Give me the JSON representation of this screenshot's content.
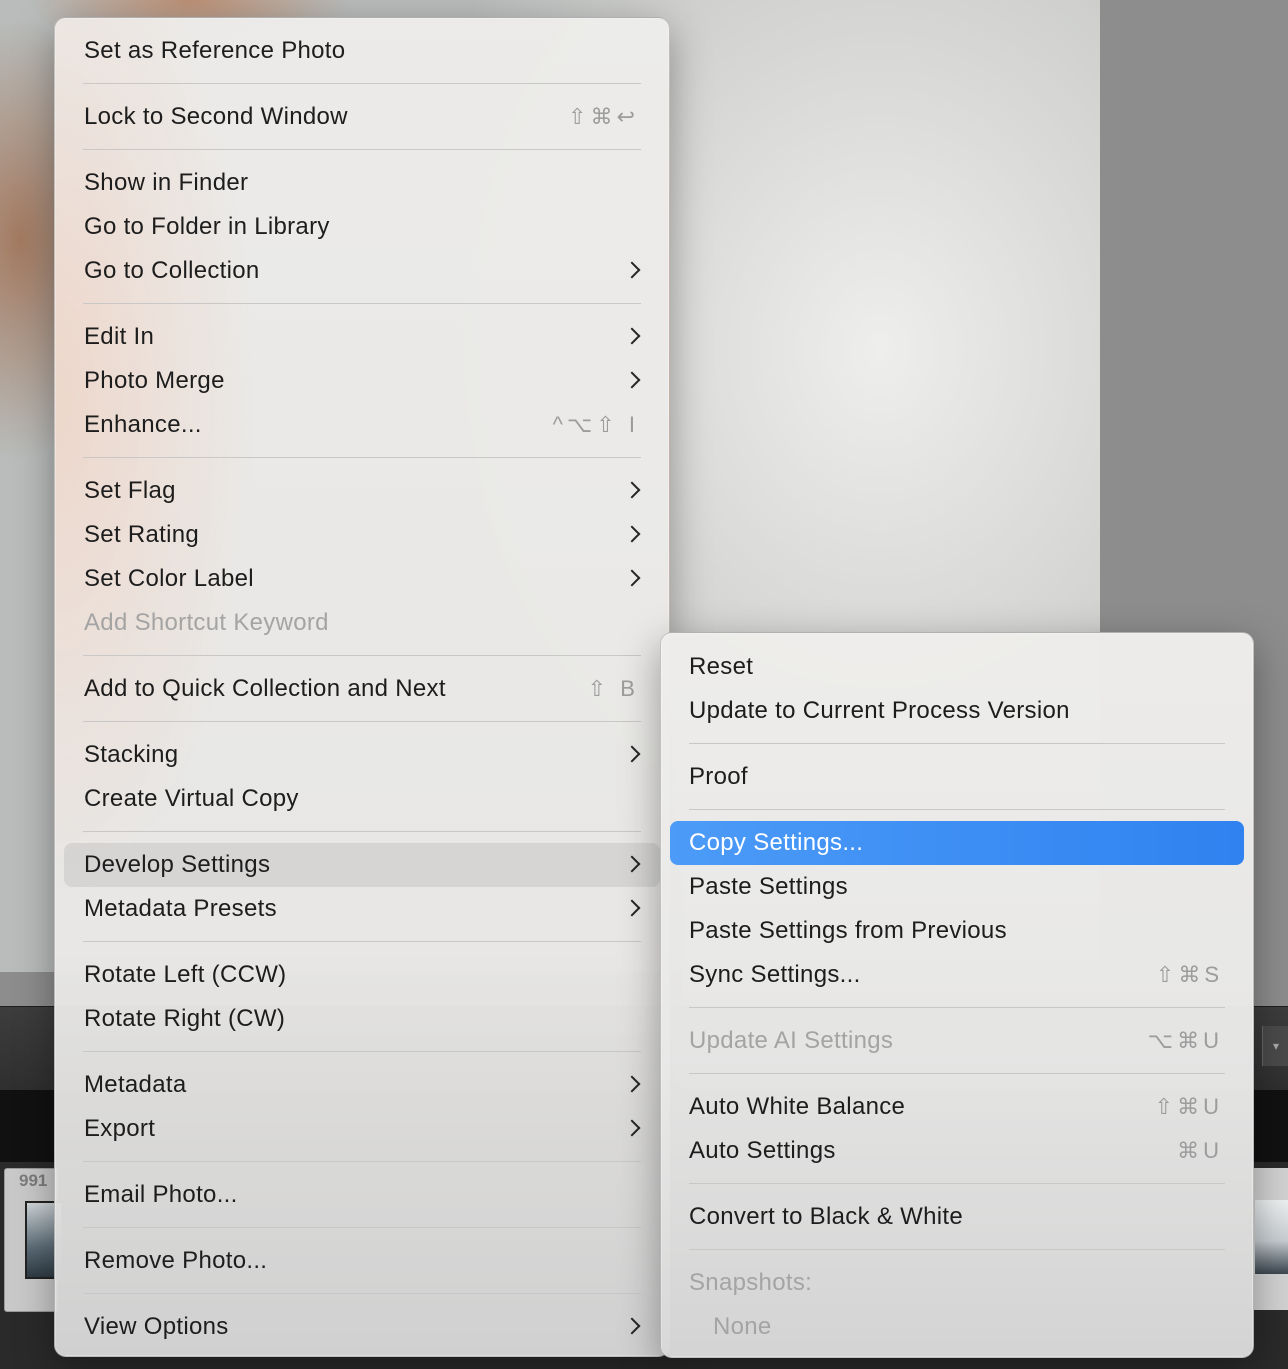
{
  "background": {
    "filmstrip_thumb_number": "991"
  },
  "context_menu": {
    "groups": [
      [
        {
          "label": "Set as Reference Photo"
        }
      ],
      [
        {
          "label": "Lock to Second Window",
          "shortcut": "⇧⌘↩"
        }
      ],
      [
        {
          "label": "Show in Finder"
        },
        {
          "label": "Go to Folder in Library"
        },
        {
          "label": "Go to Collection",
          "submenu": true
        }
      ],
      [
        {
          "label": "Edit In",
          "submenu": true
        },
        {
          "label": "Photo Merge",
          "submenu": true
        },
        {
          "label": "Enhance...",
          "shortcut": "^⌥⇧ I"
        }
      ],
      [
        {
          "label": "Set Flag",
          "submenu": true
        },
        {
          "label": "Set Rating",
          "submenu": true
        },
        {
          "label": "Set Color Label",
          "submenu": true
        },
        {
          "label": "Add Shortcut Keyword",
          "disabled": true
        }
      ],
      [
        {
          "label": "Add to Quick Collection and Next",
          "shortcut": "⇧ B"
        }
      ],
      [
        {
          "label": "Stacking",
          "submenu": true
        },
        {
          "label": "Create Virtual Copy"
        }
      ],
      [
        {
          "label": "Develop Settings",
          "submenu": true,
          "hover": true
        },
        {
          "label": "Metadata Presets",
          "submenu": true
        }
      ],
      [
        {
          "label": "Rotate Left (CCW)"
        },
        {
          "label": "Rotate Right (CW)"
        }
      ],
      [
        {
          "label": "Metadata",
          "submenu": true
        },
        {
          "label": "Export",
          "submenu": true
        }
      ],
      [
        {
          "label": "Email Photo..."
        }
      ],
      [
        {
          "label": "Remove Photo..."
        }
      ],
      [
        {
          "label": "View Options",
          "submenu": true
        }
      ]
    ]
  },
  "develop_submenu": {
    "groups": [
      [
        {
          "label": "Reset"
        },
        {
          "label": "Update to Current Process Version"
        }
      ],
      [
        {
          "label": "Proof"
        }
      ],
      [
        {
          "label": "Copy Settings...",
          "selected": true
        },
        {
          "label": "Paste Settings"
        },
        {
          "label": "Paste Settings from Previous"
        },
        {
          "label": "Sync Settings...",
          "shortcut": "⇧⌘S"
        }
      ],
      [
        {
          "label": "Update AI Settings",
          "shortcut": "⌥⌘U",
          "disabled": true
        }
      ],
      [
        {
          "label": "Auto White Balance",
          "shortcut": "⇧⌘U"
        },
        {
          "label": "Auto Settings",
          "shortcut": "⌘U"
        }
      ],
      [
        {
          "label": "Convert to Black & White"
        }
      ]
    ],
    "snapshots": {
      "header": "Snapshots:",
      "items": [
        {
          "label": "None",
          "disabled": true
        }
      ]
    }
  },
  "colors": {
    "selection_blue": "#3a8cf5",
    "menu_background": "#ecebe9",
    "disabled_text": "#a4a4a4"
  }
}
